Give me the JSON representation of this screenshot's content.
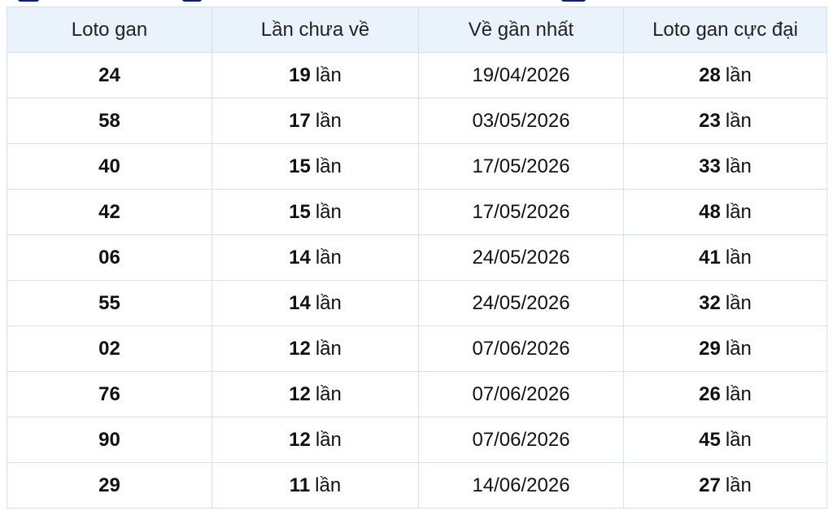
{
  "table": {
    "headers": [
      "Loto gan",
      "Lần chưa về",
      "Về gần nhất",
      "Loto gan cực đại"
    ],
    "unit": "lần",
    "rows": [
      {
        "number": "24",
        "absent": "19",
        "last_seen": "19/04/2026",
        "max_gap": "28"
      },
      {
        "number": "58",
        "absent": "17",
        "last_seen": "03/05/2026",
        "max_gap": "23"
      },
      {
        "number": "40",
        "absent": "15",
        "last_seen": "17/05/2026",
        "max_gap": "33"
      },
      {
        "number": "42",
        "absent": "15",
        "last_seen": "17/05/2026",
        "max_gap": "48"
      },
      {
        "number": "06",
        "absent": "14",
        "last_seen": "24/05/2026",
        "max_gap": "41"
      },
      {
        "number": "55",
        "absent": "14",
        "last_seen": "24/05/2026",
        "max_gap": "32"
      },
      {
        "number": "02",
        "absent": "12",
        "last_seen": "07/06/2026",
        "max_gap": "29"
      },
      {
        "number": "76",
        "absent": "12",
        "last_seen": "07/06/2026",
        "max_gap": "26"
      },
      {
        "number": "90",
        "absent": "12",
        "last_seen": "07/06/2026",
        "max_gap": "45"
      },
      {
        "number": "29",
        "absent": "11",
        "last_seen": "14/06/2026",
        "max_gap": "27"
      }
    ]
  },
  "colors": {
    "header_bg": "#eaf2fb",
    "border": "#d6e0ec",
    "date_link": "#1f45b8",
    "title_text": "#0b1f6b"
  }
}
